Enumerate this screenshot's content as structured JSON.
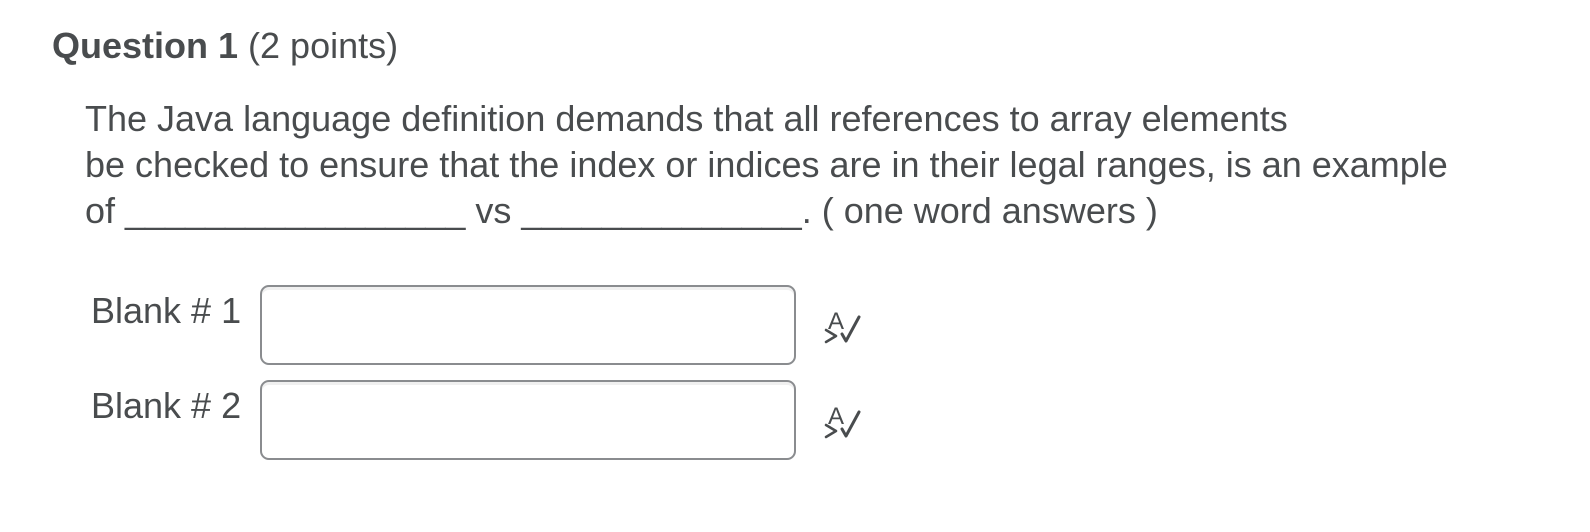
{
  "question": {
    "title": "Question 1",
    "points": "(2 points)",
    "text_lines": [
      "The Java language definition demands that all references to array elements",
      "be checked to ensure that the index or indices are in their legal ranges, is an example",
      "of _________________ vs ______________. ( one word answers )"
    ]
  },
  "blanks": [
    {
      "label": "Blank # 1",
      "value": "",
      "placeholder": ""
    },
    {
      "label": "Blank # 2",
      "value": "",
      "placeholder": ""
    }
  ],
  "icons": {
    "spell_check": "spell-check-icon"
  },
  "colors": {
    "text": "#494c4e",
    "input_border": "#8a8c8f"
  }
}
